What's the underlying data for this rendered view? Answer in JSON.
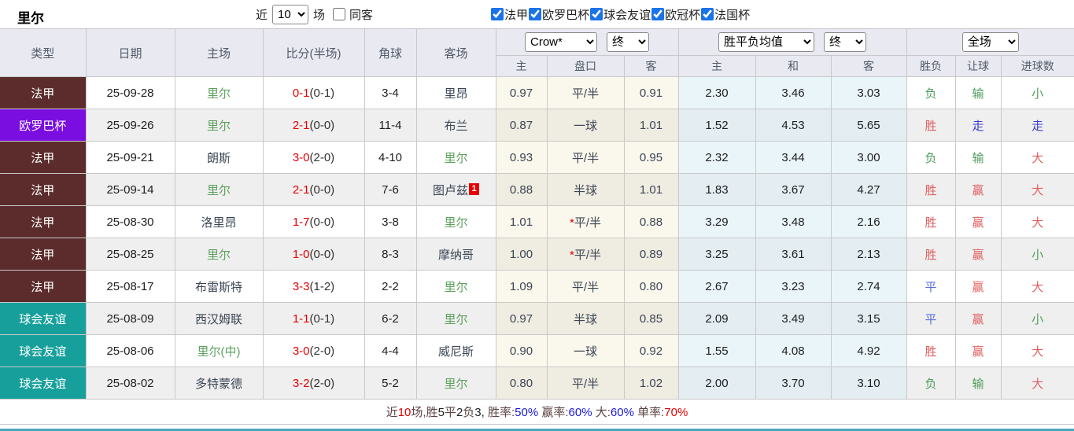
{
  "colors": {
    "type_bg": {
      "法甲": "#5c2c2c",
      "欧罗巴杯": "#7a0de0",
      "球会友谊": "#17a09b"
    },
    "result": {
      "red": "#e25f5f",
      "green": "#4e9d5c",
      "blue": "#5b6fd8",
      "deep_blue": "#3b3bd0"
    },
    "score_red": "#e60000",
    "lille_green": "#5da05d",
    "checkbox_accent": "#1b73e8",
    "bottom_line": "#4fa4ba",
    "footer": {
      "label": "#5c4343",
      "dark": "#222222",
      "red": "#e60000",
      "blue": "#1a1adb"
    }
  },
  "topbar": {
    "title": "里尔",
    "recent_label": "近",
    "recent_value": "10",
    "matches_label": "场",
    "same_away": {
      "label": "同客",
      "checked": false
    },
    "leagues": [
      {
        "label": "法甲",
        "checked": true
      },
      {
        "label": "欧罗巴杯",
        "checked": true
      },
      {
        "label": "球会友谊",
        "checked": true
      },
      {
        "label": "欧冠杯",
        "checked": true
      },
      {
        "label": "法国杯",
        "checked": true
      }
    ]
  },
  "table": {
    "headers": {
      "type": "类型",
      "date": "日期",
      "home": "主场",
      "score": "比分(半场)",
      "corner": "角球",
      "away": "客场",
      "asian_sub": [
        "主",
        "盘口",
        "客"
      ],
      "europe_sub": [
        "主",
        "和",
        "客"
      ],
      "result_sub": [
        "胜负",
        "让球",
        "进球数"
      ]
    },
    "controls": {
      "bookmaker": "Crow*",
      "asian_time": "终",
      "europe_type": "胜平负均值",
      "europe_time": "终",
      "scope": "全场"
    },
    "rows": [
      {
        "type": "法甲",
        "date": "25-09-28",
        "home": "里尔",
        "home_highlight": true,
        "score": "0-1",
        "half": "(0-1)",
        "corner": "3-4",
        "away": "里昂",
        "away_highlight": false,
        "away_badge": "",
        "asian_home": "0.97",
        "handicap": "平/半",
        "handicap_star": false,
        "asian_away": "0.91",
        "europe_home": "2.30",
        "europe_draw": "3.46",
        "europe_away": "3.03",
        "outcome": {
          "text": "负",
          "color": "green"
        },
        "handicap_result": {
          "text": "输",
          "color": "green"
        },
        "goals_result": {
          "text": "小",
          "color": "green"
        }
      },
      {
        "type": "欧罗巴杯",
        "date": "25-09-26",
        "home": "里尔",
        "home_highlight": true,
        "score": "2-1",
        "half": "(0-0)",
        "corner": "11-4",
        "away": "布兰",
        "away_highlight": false,
        "away_badge": "",
        "asian_home": "0.87",
        "handicap": "一球",
        "handicap_star": false,
        "asian_away": "1.01",
        "europe_home": "1.52",
        "europe_draw": "4.53",
        "europe_away": "5.65",
        "outcome": {
          "text": "胜",
          "color": "red"
        },
        "handicap_result": {
          "text": "走",
          "color": "deep_blue"
        },
        "goals_result": {
          "text": "走",
          "color": "deep_blue"
        }
      },
      {
        "type": "法甲",
        "date": "25-09-21",
        "home": "朗斯",
        "home_highlight": false,
        "score": "3-0",
        "half": "(2-0)",
        "corner": "4-10",
        "away": "里尔",
        "away_highlight": true,
        "away_badge": "",
        "asian_home": "0.93",
        "handicap": "平/半",
        "handicap_star": false,
        "asian_away": "0.95",
        "europe_home": "2.32",
        "europe_draw": "3.44",
        "europe_away": "3.00",
        "outcome": {
          "text": "负",
          "color": "green"
        },
        "handicap_result": {
          "text": "输",
          "color": "green"
        },
        "goals_result": {
          "text": "大",
          "color": "red"
        }
      },
      {
        "type": "法甲",
        "date": "25-09-14",
        "home": "里尔",
        "home_highlight": true,
        "score": "2-1",
        "half": "(0-0)",
        "corner": "7-6",
        "away": "图卢兹",
        "away_highlight": false,
        "away_badge": "1",
        "asian_home": "0.88",
        "handicap": "半球",
        "handicap_star": false,
        "asian_away": "1.01",
        "europe_home": "1.83",
        "europe_draw": "3.67",
        "europe_away": "4.27",
        "outcome": {
          "text": "胜",
          "color": "red"
        },
        "handicap_result": {
          "text": "赢",
          "color": "red"
        },
        "goals_result": {
          "text": "大",
          "color": "red"
        }
      },
      {
        "type": "法甲",
        "date": "25-08-30",
        "home": "洛里昂",
        "home_highlight": false,
        "score": "1-7",
        "half": "(0-0)",
        "corner": "3-8",
        "away": "里尔",
        "away_highlight": true,
        "away_badge": "",
        "asian_home": "1.01",
        "handicap": "平/半",
        "handicap_star": true,
        "asian_away": "0.88",
        "europe_home": "3.29",
        "europe_draw": "3.48",
        "europe_away": "2.16",
        "outcome": {
          "text": "胜",
          "color": "red"
        },
        "handicap_result": {
          "text": "赢",
          "color": "red"
        },
        "goals_result": {
          "text": "大",
          "color": "red"
        }
      },
      {
        "type": "法甲",
        "date": "25-08-25",
        "home": "里尔",
        "home_highlight": true,
        "score": "1-0",
        "half": "(0-0)",
        "corner": "8-3",
        "away": "摩纳哥",
        "away_highlight": false,
        "away_badge": "",
        "asian_home": "1.00",
        "handicap": "平/半",
        "handicap_star": true,
        "asian_away": "0.89",
        "europe_home": "3.25",
        "europe_draw": "3.61",
        "europe_away": "2.13",
        "outcome": {
          "text": "胜",
          "color": "red"
        },
        "handicap_result": {
          "text": "赢",
          "color": "red"
        },
        "goals_result": {
          "text": "小",
          "color": "green"
        }
      },
      {
        "type": "法甲",
        "date": "25-08-17",
        "home": "布雷斯特",
        "home_highlight": false,
        "score": "3-3",
        "half": "(1-2)",
        "corner": "2-2",
        "away": "里尔",
        "away_highlight": true,
        "away_badge": "",
        "asian_home": "1.09",
        "handicap": "平/半",
        "handicap_star": false,
        "asian_away": "0.80",
        "europe_home": "2.67",
        "europe_draw": "3.23",
        "europe_away": "2.74",
        "outcome": {
          "text": "平",
          "color": "blue"
        },
        "handicap_result": {
          "text": "赢",
          "color": "red"
        },
        "goals_result": {
          "text": "大",
          "color": "red"
        }
      },
      {
        "type": "球会友谊",
        "date": "25-08-09",
        "home": "西汉姆联",
        "home_highlight": false,
        "score": "1-1",
        "half": "(0-1)",
        "corner": "6-2",
        "away": "里尔",
        "away_highlight": true,
        "away_badge": "",
        "asian_home": "0.97",
        "handicap": "半球",
        "handicap_star": false,
        "asian_away": "0.85",
        "europe_home": "2.09",
        "europe_draw": "3.49",
        "europe_away": "3.15",
        "outcome": {
          "text": "平",
          "color": "blue"
        },
        "handicap_result": {
          "text": "赢",
          "color": "red"
        },
        "goals_result": {
          "text": "小",
          "color": "green"
        }
      },
      {
        "type": "球会友谊",
        "date": "25-08-06",
        "home": "里尔(中)",
        "home_highlight": true,
        "score": "3-0",
        "half": "(2-0)",
        "corner": "4-4",
        "away": "威尼斯",
        "away_highlight": false,
        "away_badge": "",
        "asian_home": "0.90",
        "handicap": "一球",
        "handicap_star": false,
        "asian_away": "0.92",
        "europe_home": "1.55",
        "europe_draw": "4.08",
        "europe_away": "4.92",
        "outcome": {
          "text": "胜",
          "color": "red"
        },
        "handicap_result": {
          "text": "赢",
          "color": "red"
        },
        "goals_result": {
          "text": "大",
          "color": "red"
        }
      },
      {
        "type": "球会友谊",
        "date": "25-08-02",
        "home": "多特蒙德",
        "home_highlight": false,
        "score": "3-2",
        "half": "(2-0)",
        "corner": "5-2",
        "away": "里尔",
        "away_highlight": true,
        "away_badge": "",
        "asian_home": "0.80",
        "handicap": "平/半",
        "handicap_star": false,
        "asian_away": "1.02",
        "europe_home": "2.00",
        "europe_draw": "3.70",
        "europe_away": "3.10",
        "outcome": {
          "text": "负",
          "color": "green"
        },
        "handicap_result": {
          "text": "输",
          "color": "green"
        },
        "goals_result": {
          "text": "大",
          "color": "red"
        }
      }
    ]
  },
  "footer": {
    "segments": [
      {
        "text": "近",
        "color": "label"
      },
      {
        "text": "10",
        "color": "red"
      },
      {
        "text": "场,胜",
        "color": "label"
      },
      {
        "text": "5",
        "color": "dark"
      },
      {
        "text": "平",
        "color": "label"
      },
      {
        "text": "2",
        "color": "dark"
      },
      {
        "text": "负",
        "color": "label"
      },
      {
        "text": "3, ",
        "color": "dark"
      },
      {
        "text": "胜率:",
        "color": "label"
      },
      {
        "text": "50%",
        "color": "blue"
      },
      {
        "text": " 赢率:",
        "color": "label"
      },
      {
        "text": "60%",
        "color": "blue"
      },
      {
        "text": " 大:",
        "color": "label"
      },
      {
        "text": "60%",
        "color": "blue"
      },
      {
        "text": " 单率:",
        "color": "label"
      },
      {
        "text": "70%",
        "color": "red"
      }
    ]
  }
}
